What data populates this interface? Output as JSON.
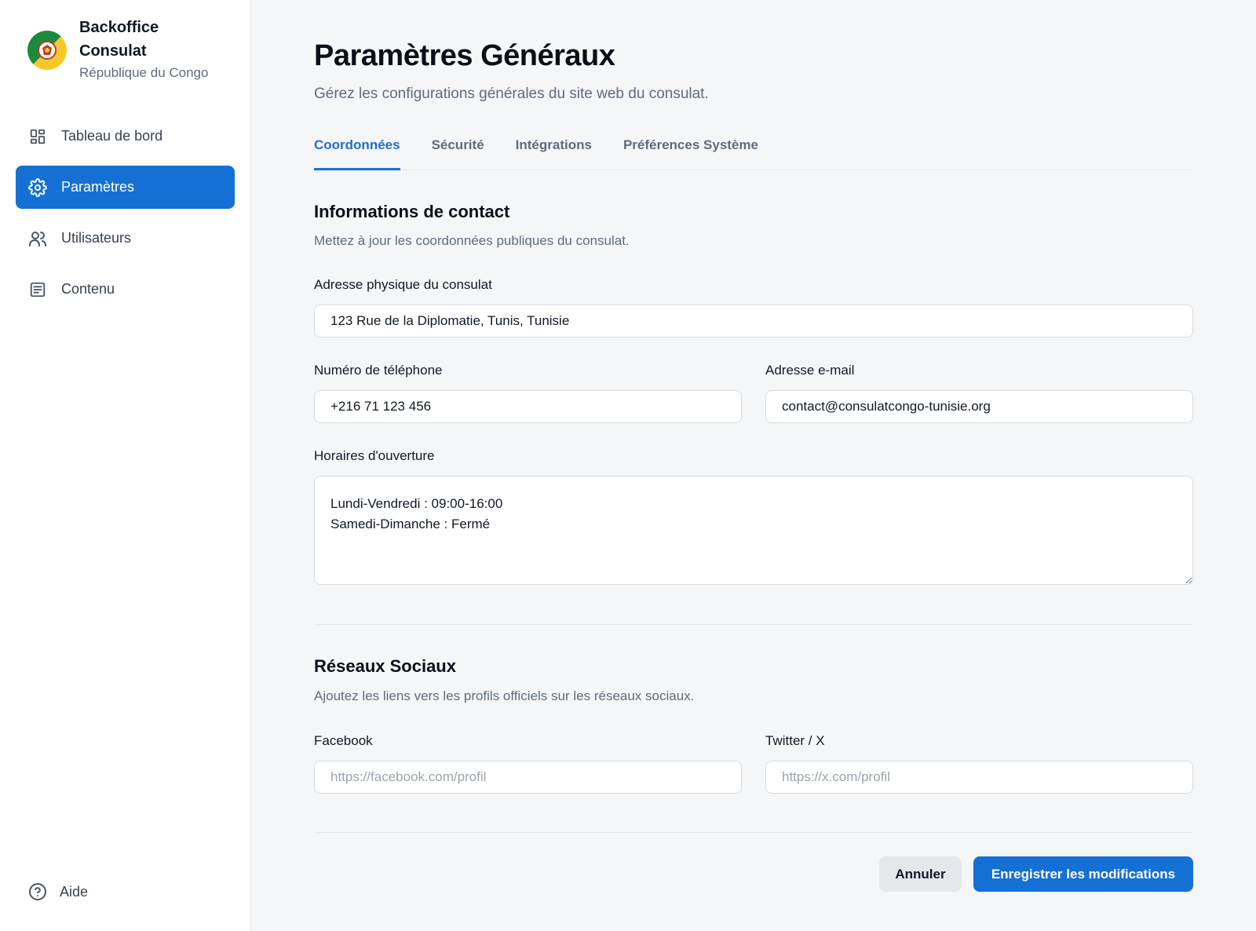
{
  "brand": {
    "title": "Backoffice Consulat",
    "subtitle": "République du Congo"
  },
  "sidebar": {
    "items": [
      {
        "label": "Tableau de bord",
        "icon": "dashboard-icon"
      },
      {
        "label": "Paramètres",
        "icon": "gear-icon",
        "active": true
      },
      {
        "label": "Utilisateurs",
        "icon": "users-icon"
      },
      {
        "label": "Contenu",
        "icon": "document-icon"
      }
    ],
    "help": {
      "label": "Aide",
      "icon": "help-circle-icon"
    }
  },
  "header": {
    "title": "Paramètres Généraux",
    "subtitle": "Gérez les configurations générales du site web du consulat."
  },
  "tabs": [
    {
      "label": "Coordonnées",
      "active": true
    },
    {
      "label": "Sécurité"
    },
    {
      "label": "Intégrations"
    },
    {
      "label": "Préférences Système"
    }
  ],
  "contact": {
    "title": "Informations de contact",
    "subtitle": "Mettez à jour les coordonnées publiques du consulat.",
    "address_label": "Adresse physique du consulat",
    "address_value": "123 Rue de la Diplomatie, Tunis, Tunisie",
    "phone_label": "Numéro de téléphone",
    "phone_value": "+216 71 123 456",
    "email_label": "Adresse e-mail",
    "email_value": "contact@consulatcongo-tunisie.org",
    "hours_label": "Horaires d'ouverture",
    "hours_value": "Lundi-Vendredi : 09:00-16:00\nSamedi-Dimanche : Fermé"
  },
  "social": {
    "title": "Réseaux Sociaux",
    "subtitle": "Ajoutez les liens vers les profils officiels sur les réseaux sociaux.",
    "facebook_label": "Facebook",
    "facebook_placeholder": "https://facebook.com/profil",
    "twitter_label": "Twitter / X",
    "twitter_placeholder": "https://x.com/profil"
  },
  "actions": {
    "cancel_label": "Annuler",
    "save_label": "Enregistrer les modifications"
  },
  "colors": {
    "accent": "#1570d6",
    "background": "#f5f6f8",
    "muted_text": "#5f6b7e"
  }
}
